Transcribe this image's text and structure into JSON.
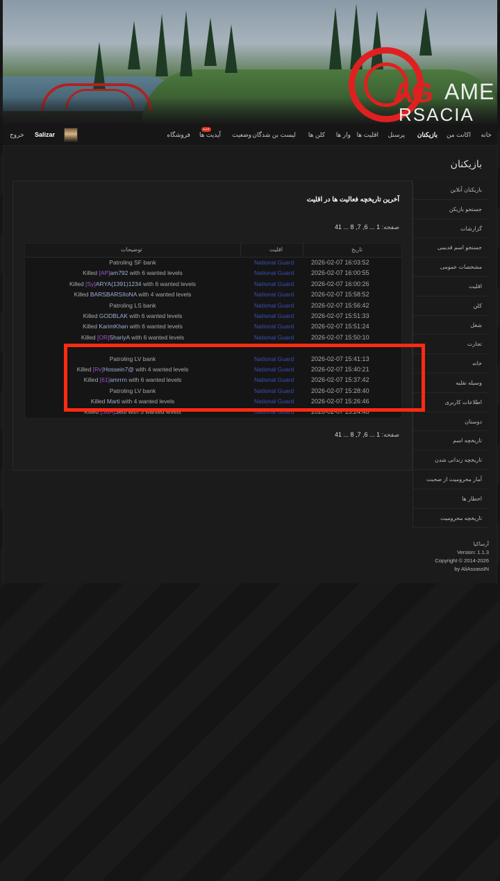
{
  "logo": {
    "part1": "AG",
    "part2": "AME",
    "part3": "RSACIA"
  },
  "nav": {
    "items": [
      {
        "label": "خانه"
      },
      {
        "label": "اکانت من"
      },
      {
        "label": "بازیکنان"
      },
      {
        "label": "پرسنل"
      },
      {
        "label": "اقلیت ها"
      },
      {
        "label": "وار ها"
      },
      {
        "label": "کلن ها"
      },
      {
        "label": "لیست بن شدگان"
      },
      {
        "label": "وضعیت"
      },
      {
        "label": "آپدیت ها"
      },
      {
        "label": "فروشگاه"
      }
    ],
    "badge": "جدید",
    "username": "Salizar",
    "logout": "خروج"
  },
  "page_heading": "بازیکنان",
  "sidebar": {
    "items": [
      "بازیکنان آنلاین",
      "جستجو بازیکن",
      "گزارشات",
      "جستجو اسم قدیمی",
      "مشخصات عمومی",
      "اقلیت",
      "کلن",
      "شغل",
      "تجارت",
      "خانه",
      "وسیله نقلیه",
      "اطلاعات کاربری",
      "دوستان",
      "تاریخچه اسم",
      "تاریخچه زندانی شدن",
      "آمار محرومیت از صحبت",
      "اخطار ها",
      "تاریخچه محرومیت"
    ]
  },
  "panel": {
    "title": "آخرین تاریخچه فعالیت ها در اقلیت",
    "pager_label": "صفحه:",
    "pager_pages": "1 ... 6, 7, 8 ... 41"
  },
  "table": {
    "headers": {
      "date": "تاریخ",
      "faction": "اقلیت",
      "description": "توضیحات"
    },
    "rows": [
      {
        "date": "2026-02-07 16:03:52",
        "faction": "National Guard",
        "pre": "Patroling SF bank",
        "tag": "",
        "name": "",
        "post": ""
      },
      {
        "date": "2026-02-07 16:00:55",
        "faction": "National Guard",
        "pre": "Killed ",
        "tag": "[AP]",
        "name": "am792",
        "post": " with 6 wanted levels"
      },
      {
        "date": "2026-02-07 16:00:26",
        "faction": "National Guard",
        "pre": "Killed ",
        "tag": "[Sy]",
        "name": "ARYA(1391)1234",
        "post": " with 6 wanted levels"
      },
      {
        "date": "2026-02-07 15:58:52",
        "faction": "National Guard",
        "pre": "Killed ",
        "tag": "",
        "name": "BARSBARSIIoNA",
        "post": " with 4 wanted levels"
      },
      {
        "date": "2026-02-07 15:56:42",
        "faction": "National Guard",
        "pre": "Patroling LS bank",
        "tag": "",
        "name": "",
        "post": ""
      },
      {
        "date": "2026-02-07 15:51:33",
        "faction": "National Guard",
        "pre": "Killed ",
        "tag": "",
        "name": "GODBLAK",
        "post": " with 6 wanted levels"
      },
      {
        "date": "2026-02-07 15:51:24",
        "faction": "National Guard",
        "pre": "Killed ",
        "tag": "",
        "name": "KarimKhan",
        "post": " with 6 wanted levels"
      },
      {
        "date": "2026-02-07 15:50:10",
        "faction": "National Guard",
        "pre": "Killed ",
        "tag": "[OR]",
        "name": "ShariyA",
        "post": " with 6 wanted levels"
      },
      {
        "date": "",
        "faction": "",
        "pre": "",
        "tag": "",
        "name": "",
        "post": ""
      },
      {
        "date": "2026-02-07 15:41:13",
        "faction": "National Guard",
        "pre": "Patroling LV bank",
        "tag": "",
        "name": "",
        "post": ""
      },
      {
        "date": "2026-02-07 15:40:21",
        "faction": "National Guard",
        "pre": "Killed ",
        "tag": "[Rv]",
        "name": "Hossein7@",
        "post": " with 4 wanted levels"
      },
      {
        "date": "2026-02-07 15:37:42",
        "faction": "National Guard",
        "pre": "Killed ",
        "tag": "[61]",
        "name": "amrrrn",
        "post": " with 6 wanted levels"
      },
      {
        "date": "2026-02-07 15:28:40",
        "faction": "National Guard",
        "pre": "Patroling LV bank",
        "tag": "",
        "name": "",
        "post": ""
      },
      {
        "date": "2026-02-07 15:26:46",
        "faction": "National Guard",
        "pre": "Killed ",
        "tag": "",
        "name": "Marti",
        "post": " with 4 wanted levels"
      },
      {
        "date": "2026-02-07 15:24:46",
        "faction": "National Guard",
        "pre": "Killed ",
        "tag": "[SdA]",
        "name": "Setti",
        "post": " with 3 wanted levels"
      }
    ]
  },
  "footer": {
    "title": "آرساکیا",
    "version": "Version: 1.1.3",
    "copyright": "Copyright © 2014-2026",
    "author": "by AliAssassIN"
  }
}
